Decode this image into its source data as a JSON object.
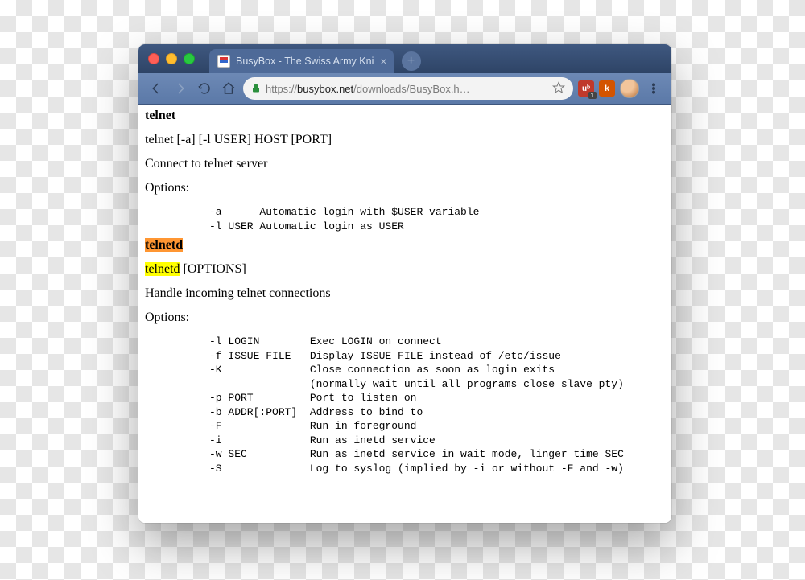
{
  "window": {
    "tab_title": "BusyBox - The Swiss Army Kni",
    "new_tab_glyph": "+",
    "tab_close_glyph": "×"
  },
  "toolbar": {
    "url_prefix": "https://",
    "url_host": "busybox.net",
    "url_path": "/downloads/BusyBox.h…",
    "ublock_badge": "1",
    "k_label": "k"
  },
  "doc": {
    "telnet": {
      "head": "telnet",
      "usage": "telnet [-a] [-l USER] HOST [PORT]",
      "desc": "Connect to telnet server",
      "options_label": "Options:",
      "options_pre": "-a      Automatic login with $USER variable\n-l USER Automatic login as USER"
    },
    "telnetd": {
      "head": "telnetd",
      "usage_hl": "telnetd",
      "usage_rest": " [OPTIONS]",
      "desc": "Handle incoming telnet connections",
      "options_label": "Options:",
      "options_pre": "-l LOGIN        Exec LOGIN on connect\n-f ISSUE_FILE   Display ISSUE_FILE instead of /etc/issue\n-K              Close connection as soon as login exits\n                (normally wait until all programs close slave pty)\n-p PORT         Port to listen on\n-b ADDR[:PORT]  Address to bind to\n-F              Run in foreground\n-i              Run as inetd service\n-w SEC          Run as inetd service in wait mode, linger time SEC\n-S              Log to syslog (implied by -i or without -F and -w)"
    }
  }
}
